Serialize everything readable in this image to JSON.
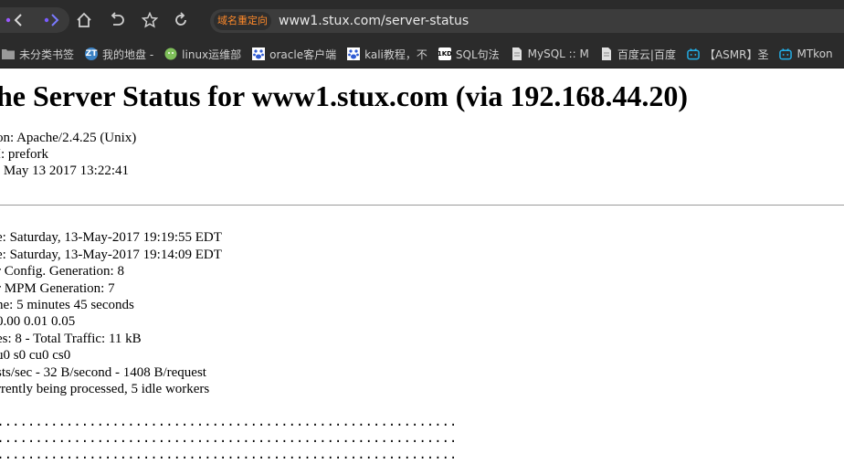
{
  "browser": {
    "redirect_badge": "域名重定向",
    "url": "www1.stux.com/server-status"
  },
  "bookmarks": [
    {
      "label": "未分类书签",
      "icon": "folder-icon",
      "icon_text": "",
      "icon_color": "#9a9a9a"
    },
    {
      "label": "我的地盘 -",
      "icon": "zt-logo-icon",
      "icon_text": "ZT",
      "icon_color": "#3b82c4"
    },
    {
      "label": "linux运维部",
      "icon": "wechat-icon",
      "icon_text": "",
      "icon_color": "#7fbf5a"
    },
    {
      "label": "oracle客户端",
      "icon": "baidu-paw-icon",
      "icon_text": "",
      "icon_color": "#2f5bd3"
    },
    {
      "label": "kali教程，不",
      "icon": "baidu-paw-icon",
      "icon_text": "",
      "icon_color": "#2f5bd3"
    },
    {
      "label": "SQL句法",
      "icon": "1kd-logo-icon",
      "icon_text": "1KD",
      "icon_color": "#ffffff"
    },
    {
      "label": "MySQL :: M",
      "icon": "page-icon",
      "icon_text": "",
      "icon_color": "#e0e0e0"
    },
    {
      "label": "百度云|百度",
      "icon": "page-icon",
      "icon_text": "",
      "icon_color": "#e0e0e0"
    },
    {
      "label": "【ASMR】圣",
      "icon": "bilibili-icon",
      "icon_text": "",
      "icon_color": "#23ade5"
    },
    {
      "label": "MTkon",
      "icon": "bilibili-icon",
      "icon_text": "",
      "icon_color": "#23ade5"
    }
  ],
  "page": {
    "title": "he Server Status for www1.stux.com (via 192.168.44.20)",
    "info_lines": [
      "on: Apache/2.4.25 (Unix)",
      "I: prefork",
      ": May 13 2017 13:22:41"
    ],
    "status_lines": [
      "e: Saturday, 13-May-2017 19:19:55 EDT",
      "e: Saturday, 13-May-2017 19:14:09 EDT",
      "r Config. Generation: 8",
      "r MPM Generation: 7",
      "ne: 5 minutes 45 seconds",
      "0.00 0.01 0.05",
      "es: 8 - Total Traffic: 11 kB",
      "u0 s0 cu0 cs0",
      "sts/sec - 32 B/second - 1408 B/request",
      "rrently being processed, 5 idle workers"
    ],
    "scoreboard_lines": [
      "............................................................",
      "............................................................",
      "............................................................"
    ]
  }
}
